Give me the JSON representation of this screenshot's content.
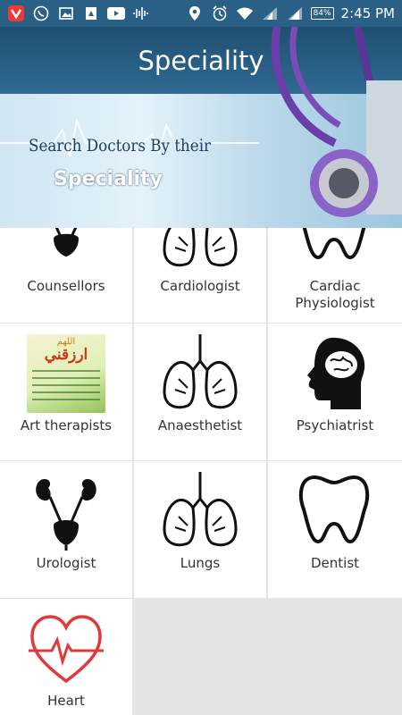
{
  "status_bar": {
    "time": "2:45 PM",
    "battery": "84%"
  },
  "header": {
    "title": "Speciality",
    "banner_line1": "Search Doctors By their",
    "banner_line2": "Speciality"
  },
  "specialities": [
    {
      "label": "Counsellors",
      "icon": "kidney-bladder-icon"
    },
    {
      "label": "Cardiologist",
      "icon": "lungs-icon"
    },
    {
      "label": "Cardiac Physiologist",
      "icon": "tooth-icon"
    },
    {
      "label": "Art therapists",
      "icon": "arabic-poster-image"
    },
    {
      "label": "Anaesthetist",
      "icon": "lungs-icon"
    },
    {
      "label": "Psychiatrist",
      "icon": "head-brain-icon"
    },
    {
      "label": "Urologist",
      "icon": "kidney-bladder-icon"
    },
    {
      "label": "Lungs",
      "icon": "lungs-icon"
    },
    {
      "label": "Dentist",
      "icon": "tooth-icon"
    },
    {
      "label": "Heart",
      "icon": "heart-pulse-icon"
    }
  ],
  "poster_text": {
    "line1": "اللهم",
    "line2": "ارزقني"
  },
  "colors": {
    "status_bar": "#2a5f86",
    "heart_red": "#e0393c"
  }
}
